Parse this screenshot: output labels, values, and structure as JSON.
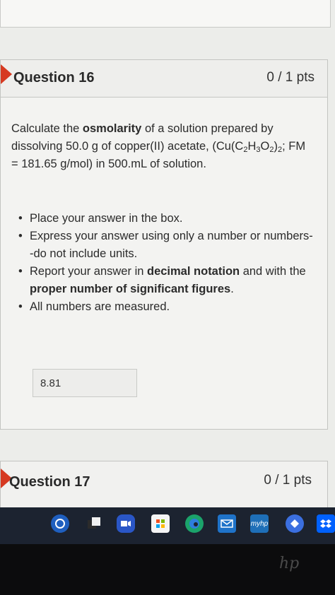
{
  "question16": {
    "title": "Question 16",
    "points": "0 / 1 pts",
    "prompt_pre": "Calculate the ",
    "prompt_bold": "osmolarity",
    "prompt_post": " of a solution prepared by dissolving 50.0 g of copper(II) acetate, (Cu(C",
    "formula_sub1": "2",
    "formula_mid1": "H",
    "formula_sub2": "3",
    "formula_mid2": "O",
    "formula_sub3": "2",
    "formula_mid3": ")",
    "formula_sub4": "2",
    "prompt_tail": "; FM = 181.65 g/mol) in 500.mL of solution.",
    "bullets": {
      "b1": "Place your answer in the box.",
      "b2": "Express your answer using only a number or numbers--do not include units.",
      "b3_pre": "Report your answer in ",
      "b3_bold1": "decimal notation",
      "b3_mid": " and with the ",
      "b3_bold2": "proper number of significant figures",
      "b3_post": ".",
      "b4": "All numbers are measured."
    },
    "answer_value": "8.81"
  },
  "question17": {
    "title": "Question 17",
    "points": "0 / 1 pts"
  },
  "taskbar": {
    "icons": [
      "start-button",
      "task-view-icon",
      "meet-icon",
      "store-icon",
      "edge-icon",
      "mail-icon",
      "myhp-icon",
      "app-icon",
      "dropbox-icon"
    ],
    "myhp_label": "myhp"
  },
  "brand": "hp"
}
